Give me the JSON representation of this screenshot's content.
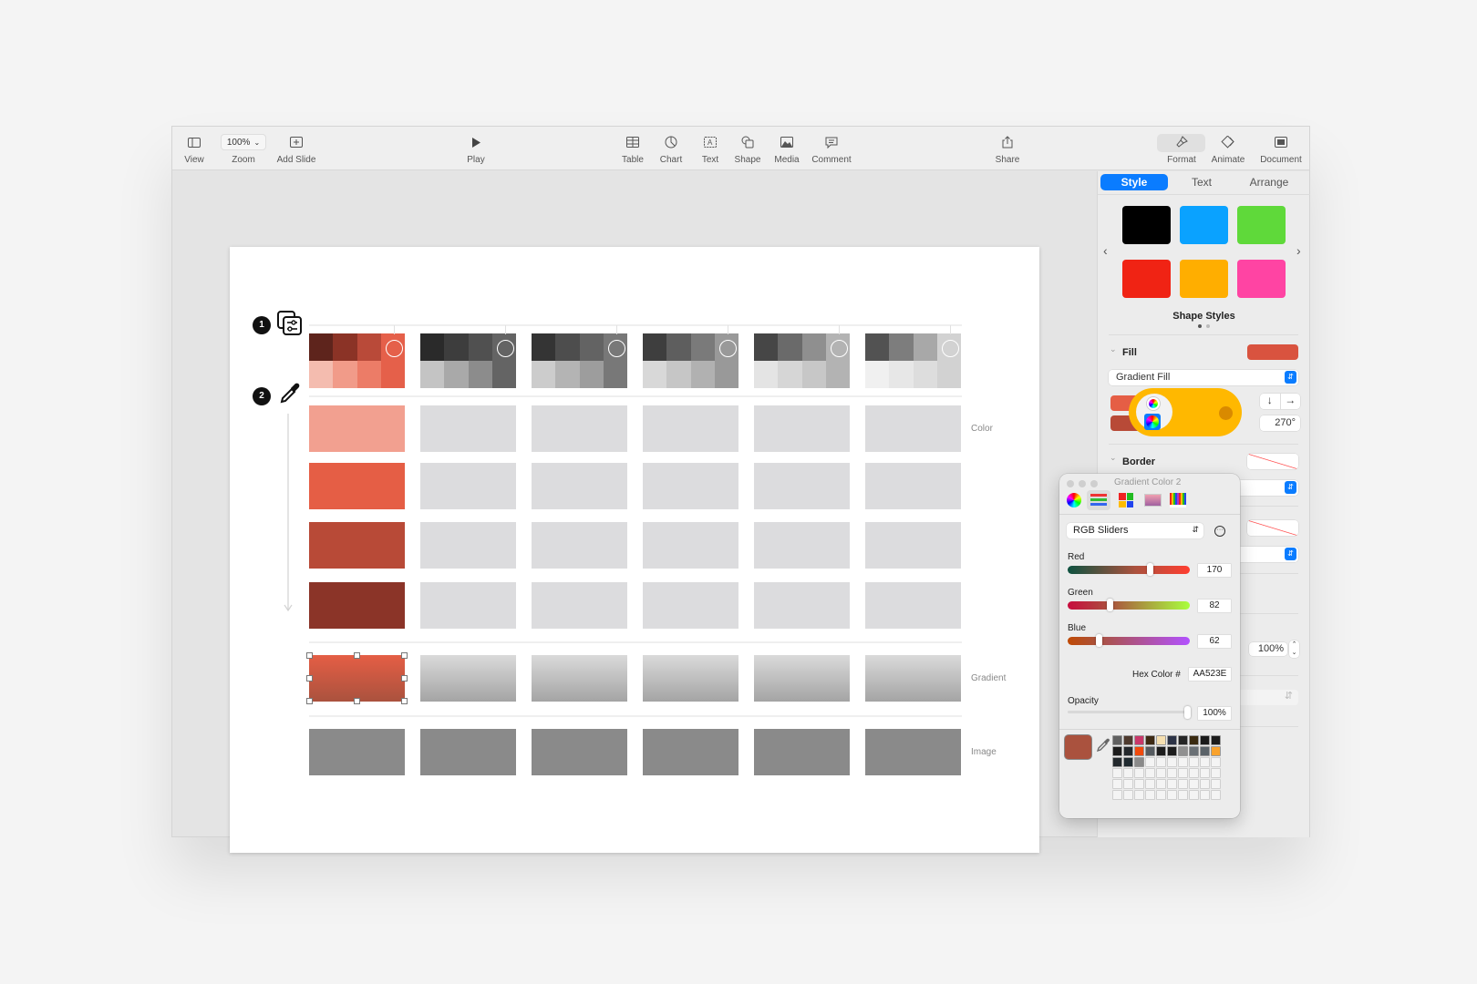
{
  "toolbar": {
    "view": "View",
    "zoom_value": "100%",
    "zoom": "Zoom",
    "add_slide": "Add Slide",
    "play": "Play",
    "table": "Table",
    "chart": "Chart",
    "text": "Text",
    "shape": "Shape",
    "media": "Media",
    "comment": "Comment",
    "share": "Share",
    "format": "Format",
    "animate": "Animate",
    "document": "Document"
  },
  "slide": {
    "markers": [
      "1",
      "2"
    ],
    "row_labels": {
      "color": "Color",
      "gradient": "Gradient",
      "image": "Image"
    },
    "palettes": [
      {
        "top": [
          "#5e241c",
          "#8b3326",
          "#b94a39",
          "#e5604a"
        ],
        "bottom": [
          "#f4bcaf",
          "#f19b89",
          "#ec7c67",
          "#e5604a"
        ]
      },
      {
        "top": [
          "#2a2a2a",
          "#3d3d3d",
          "#505050",
          "#646464"
        ],
        "bottom": [
          "#c4c4c4",
          "#a9a9a9",
          "#8c8c8c",
          "#646464"
        ]
      },
      {
        "top": [
          "#343434",
          "#4d4d4d",
          "#636363",
          "#787878"
        ],
        "bottom": [
          "#cccccc",
          "#b4b4b4",
          "#9d9d9d",
          "#787878"
        ]
      },
      {
        "top": [
          "#3e3e3e",
          "#5e5e5e",
          "#7a7a7a",
          "#999999"
        ],
        "bottom": [
          "#d8d8d8",
          "#c6c6c6",
          "#b1b1b1",
          "#999999"
        ]
      },
      {
        "top": [
          "#464646",
          "#6a6a6a",
          "#8f8f8f",
          "#b3b3b3"
        ],
        "bottom": [
          "#e4e4e4",
          "#d6d6d6",
          "#c7c7c7",
          "#b3b3b3"
        ]
      },
      {
        "top": [
          "#525252",
          "#7d7d7d",
          "#a8a8a8",
          "#d2d2d2"
        ],
        "bottom": [
          "#f0f0f0",
          "#e7e7e7",
          "#dddddd",
          "#d2d2d2"
        ]
      }
    ],
    "color_swatches": [
      "#f2a090",
      "#e55e45",
      "#b84a37",
      "#8b3428"
    ],
    "placeholder_color": "#dcdcde",
    "gradient_selected": [
      "#e55e45",
      "#aa523e"
    ],
    "gradient_gray": [
      "#dadada",
      "#a4a4a4"
    ],
    "image_color": "#8a8a8a"
  },
  "sidebar": {
    "tabs": [
      "Style",
      "Text",
      "Arrange"
    ],
    "shape_styles": [
      "#000000",
      "#0aa2ff",
      "#5fd93a",
      "#f02314",
      "#ffae00",
      "#ff44a3"
    ],
    "shape_styles_label": "Shape Styles",
    "fill_label": "Fill",
    "fill_color": "#d9533f",
    "fill_type": "Gradient Fill",
    "gradient_stop1": "#e55e45",
    "gradient_stop2": "#b84a37",
    "angle": "270°",
    "border_label": "Border",
    "opacity_value": "100%",
    "highlight_color": "#ffb800"
  },
  "color_panel": {
    "title": "Gradient Color 2",
    "mode": "RGB Sliders",
    "red_label": "Red",
    "red": "170",
    "green_label": "Green",
    "green": "82",
    "blue_label": "Blue",
    "blue": "62",
    "hex_label": "Hex Color #",
    "hex": "AA523E",
    "opacity_label": "Opacity",
    "opacity": "100%",
    "current_color": "#aa523e",
    "swatches": [
      "#606060",
      "#4e3a2e",
      "#c9386a",
      "#3d2a14",
      "#f5dfb0",
      "#2c3346",
      "#252525",
      "#3a2a10",
      "#1a1a1a",
      "#1c1c1c",
      "#1c1c1c",
      "#23272b",
      "#f04a0c",
      "#555b60",
      "#1c1c1c",
      "#1c1c1c",
      "#909090",
      "#6a7075",
      "#5a6268",
      "#f9a22c",
      "#23292d",
      "#1f2a30",
      "#8a8a8a"
    ]
  }
}
